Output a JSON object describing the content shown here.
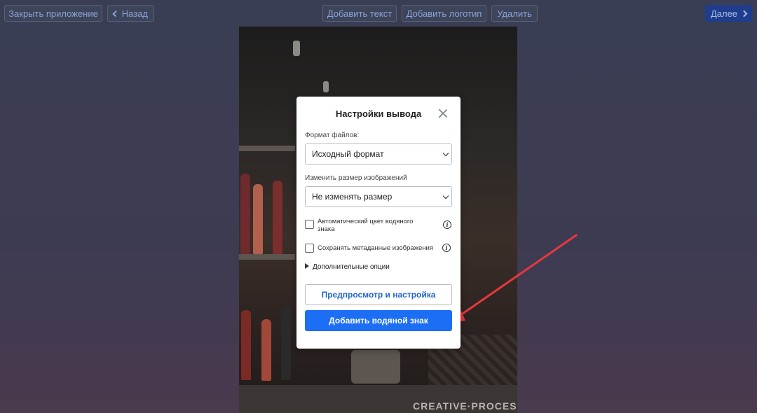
{
  "topbar": {
    "close_app": "Закрыть приложение",
    "back": "Назад",
    "add_text": "Добавить текст",
    "add_logo": "Добавить логотип",
    "delete": "Удалить",
    "next": "Далее"
  },
  "photo": {
    "watermark": "CREATIVE·PROCESS"
  },
  "modal": {
    "title": "Настройки вывода",
    "format_label": "Формат файлов:",
    "format_value": "Исходный формат",
    "resize_label": "Изменить размер изображений",
    "resize_value": "Не изменять размер",
    "auto_color_label": "Автоматический цвет водяного знака",
    "keep_metadata_label": "Сохранять метаданные изображения",
    "more_options": "Дополнительные опции",
    "preview_button": "Предпросмотр и настройка",
    "add_watermark_button": "Добавить водяной знак",
    "auto_color_checked": false,
    "keep_metadata_checked": false
  },
  "colors": {
    "primary": "#1c6ef5",
    "arrow": "#e8383c",
    "link": "#2266cc"
  },
  "icons": [
    "chevron-left-icon",
    "chevron-right-icon",
    "close-icon",
    "chevron-down-icon",
    "info-icon",
    "triangle-right-icon",
    "arrow-annotation"
  ]
}
